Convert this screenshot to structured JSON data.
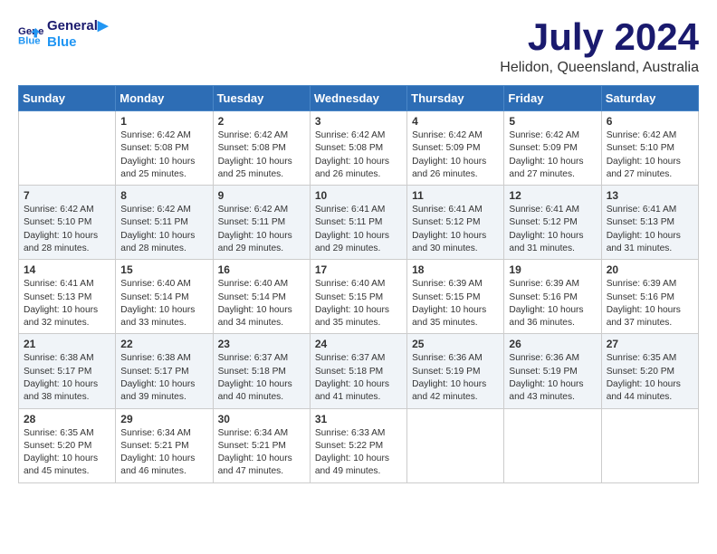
{
  "header": {
    "logo_line1": "General",
    "logo_line2": "Blue",
    "month": "July 2024",
    "location": "Helidon, Queensland, Australia"
  },
  "weekdays": [
    "Sunday",
    "Monday",
    "Tuesday",
    "Wednesday",
    "Thursday",
    "Friday",
    "Saturday"
  ],
  "weeks": [
    [
      {
        "day": "",
        "content": ""
      },
      {
        "day": "1",
        "content": "Sunrise: 6:42 AM\nSunset: 5:08 PM\nDaylight: 10 hours\nand 25 minutes."
      },
      {
        "day": "2",
        "content": "Sunrise: 6:42 AM\nSunset: 5:08 PM\nDaylight: 10 hours\nand 25 minutes."
      },
      {
        "day": "3",
        "content": "Sunrise: 6:42 AM\nSunset: 5:08 PM\nDaylight: 10 hours\nand 26 minutes."
      },
      {
        "day": "4",
        "content": "Sunrise: 6:42 AM\nSunset: 5:09 PM\nDaylight: 10 hours\nand 26 minutes."
      },
      {
        "day": "5",
        "content": "Sunrise: 6:42 AM\nSunset: 5:09 PM\nDaylight: 10 hours\nand 27 minutes."
      },
      {
        "day": "6",
        "content": "Sunrise: 6:42 AM\nSunset: 5:10 PM\nDaylight: 10 hours\nand 27 minutes."
      }
    ],
    [
      {
        "day": "7",
        "content": "Sunrise: 6:42 AM\nSunset: 5:10 PM\nDaylight: 10 hours\nand 28 minutes."
      },
      {
        "day": "8",
        "content": "Sunrise: 6:42 AM\nSunset: 5:11 PM\nDaylight: 10 hours\nand 28 minutes."
      },
      {
        "day": "9",
        "content": "Sunrise: 6:42 AM\nSunset: 5:11 PM\nDaylight: 10 hours\nand 29 minutes."
      },
      {
        "day": "10",
        "content": "Sunrise: 6:41 AM\nSunset: 5:11 PM\nDaylight: 10 hours\nand 29 minutes."
      },
      {
        "day": "11",
        "content": "Sunrise: 6:41 AM\nSunset: 5:12 PM\nDaylight: 10 hours\nand 30 minutes."
      },
      {
        "day": "12",
        "content": "Sunrise: 6:41 AM\nSunset: 5:12 PM\nDaylight: 10 hours\nand 31 minutes."
      },
      {
        "day": "13",
        "content": "Sunrise: 6:41 AM\nSunset: 5:13 PM\nDaylight: 10 hours\nand 31 minutes."
      }
    ],
    [
      {
        "day": "14",
        "content": "Sunrise: 6:41 AM\nSunset: 5:13 PM\nDaylight: 10 hours\nand 32 minutes."
      },
      {
        "day": "15",
        "content": "Sunrise: 6:40 AM\nSunset: 5:14 PM\nDaylight: 10 hours\nand 33 minutes."
      },
      {
        "day": "16",
        "content": "Sunrise: 6:40 AM\nSunset: 5:14 PM\nDaylight: 10 hours\nand 34 minutes."
      },
      {
        "day": "17",
        "content": "Sunrise: 6:40 AM\nSunset: 5:15 PM\nDaylight: 10 hours\nand 35 minutes."
      },
      {
        "day": "18",
        "content": "Sunrise: 6:39 AM\nSunset: 5:15 PM\nDaylight: 10 hours\nand 35 minutes."
      },
      {
        "day": "19",
        "content": "Sunrise: 6:39 AM\nSunset: 5:16 PM\nDaylight: 10 hours\nand 36 minutes."
      },
      {
        "day": "20",
        "content": "Sunrise: 6:39 AM\nSunset: 5:16 PM\nDaylight: 10 hours\nand 37 minutes."
      }
    ],
    [
      {
        "day": "21",
        "content": "Sunrise: 6:38 AM\nSunset: 5:17 PM\nDaylight: 10 hours\nand 38 minutes."
      },
      {
        "day": "22",
        "content": "Sunrise: 6:38 AM\nSunset: 5:17 PM\nDaylight: 10 hours\nand 39 minutes."
      },
      {
        "day": "23",
        "content": "Sunrise: 6:37 AM\nSunset: 5:18 PM\nDaylight: 10 hours\nand 40 minutes."
      },
      {
        "day": "24",
        "content": "Sunrise: 6:37 AM\nSunset: 5:18 PM\nDaylight: 10 hours\nand 41 minutes."
      },
      {
        "day": "25",
        "content": "Sunrise: 6:36 AM\nSunset: 5:19 PM\nDaylight: 10 hours\nand 42 minutes."
      },
      {
        "day": "26",
        "content": "Sunrise: 6:36 AM\nSunset: 5:19 PM\nDaylight: 10 hours\nand 43 minutes."
      },
      {
        "day": "27",
        "content": "Sunrise: 6:35 AM\nSunset: 5:20 PM\nDaylight: 10 hours\nand 44 minutes."
      }
    ],
    [
      {
        "day": "28",
        "content": "Sunrise: 6:35 AM\nSunset: 5:20 PM\nDaylight: 10 hours\nand 45 minutes."
      },
      {
        "day": "29",
        "content": "Sunrise: 6:34 AM\nSunset: 5:21 PM\nDaylight: 10 hours\nand 46 minutes."
      },
      {
        "day": "30",
        "content": "Sunrise: 6:34 AM\nSunset: 5:21 PM\nDaylight: 10 hours\nand 47 minutes."
      },
      {
        "day": "31",
        "content": "Sunrise: 6:33 AM\nSunset: 5:22 PM\nDaylight: 10 hours\nand 49 minutes."
      },
      {
        "day": "",
        "content": ""
      },
      {
        "day": "",
        "content": ""
      },
      {
        "day": "",
        "content": ""
      }
    ]
  ]
}
